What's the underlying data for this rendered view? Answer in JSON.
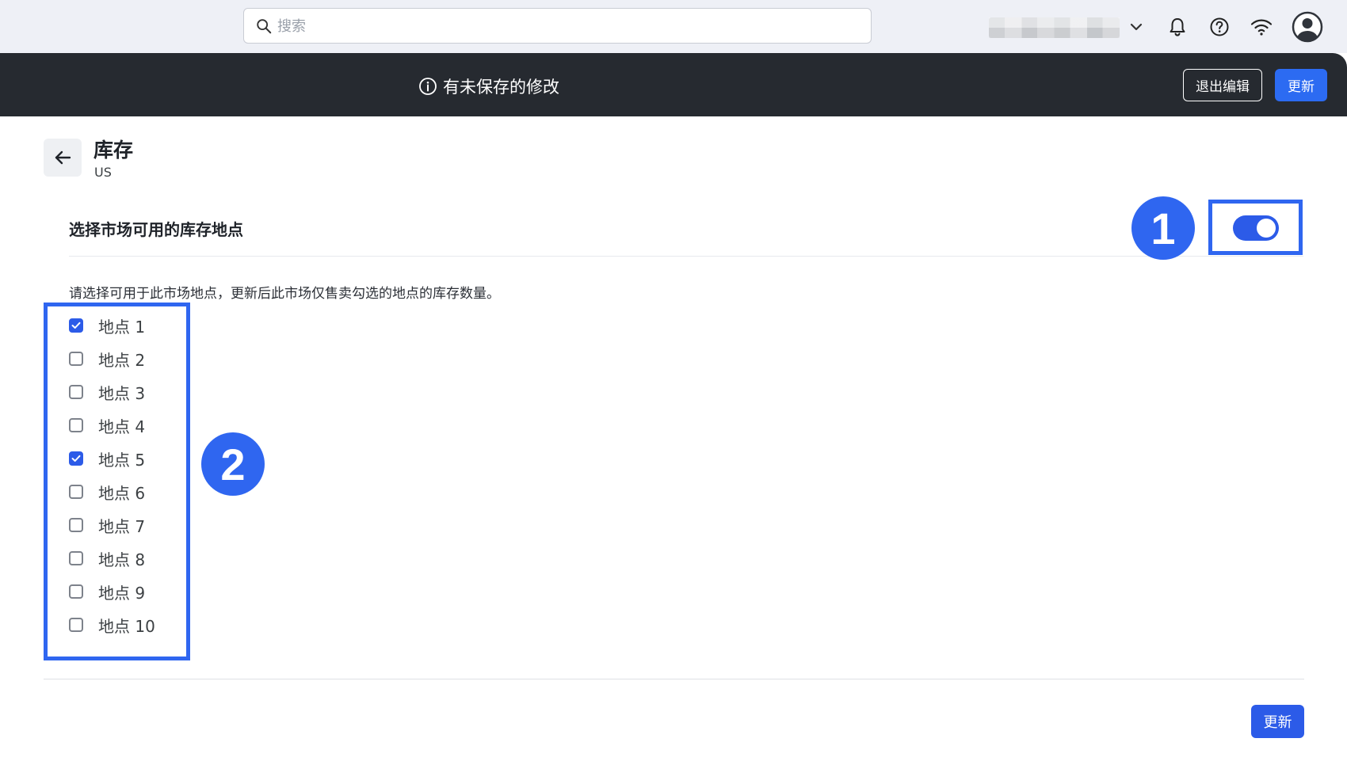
{
  "topbar": {
    "search_placeholder": "搜索",
    "icons": [
      "search-icon",
      "chevron-down-icon",
      "bell-icon",
      "help-icon",
      "wifi-icon",
      "user-avatar-icon"
    ]
  },
  "unsaved_bar": {
    "message": "有未保存的修改",
    "exit_label": "退出编辑",
    "update_label": "更新"
  },
  "header": {
    "title": "库存",
    "subtitle": "US"
  },
  "section": {
    "title": "选择市场可用的库存地点",
    "toggle_on": true,
    "description": "请选择可用于此市场地点，更新后此市场仅售卖勾选的地点的库存数量。"
  },
  "annotations": {
    "badge_1": "1",
    "badge_2": "2"
  },
  "locations": [
    {
      "label": "地点 1",
      "checked": true
    },
    {
      "label": "地点 2",
      "checked": false
    },
    {
      "label": "地点 3",
      "checked": false
    },
    {
      "label": "地点 4",
      "checked": false
    },
    {
      "label": "地点 5",
      "checked": true
    },
    {
      "label": "地点 6",
      "checked": false
    },
    {
      "label": "地点 7",
      "checked": false
    },
    {
      "label": "地点 8",
      "checked": false
    },
    {
      "label": "地点 9",
      "checked": false
    },
    {
      "label": "地点 10",
      "checked": false
    }
  ],
  "footer": {
    "update_label": "更新"
  },
  "colors": {
    "accent": "#2c5be8",
    "dark_bar": "#262a30",
    "highlight": "#2f66f0"
  }
}
